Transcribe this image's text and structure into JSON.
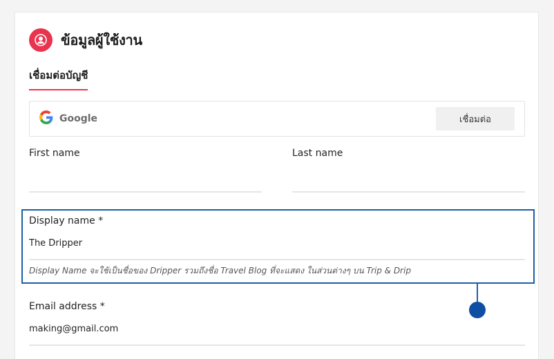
{
  "header": {
    "title": "ข้อมูลผู้ใช้งาน",
    "icon": "user-circle-icon",
    "accent_color": "#e8344f"
  },
  "tabs": [
    {
      "label": "เชื่อมต่อบัญชี",
      "active": true
    }
  ],
  "connect": {
    "provider_icon": "google-icon",
    "provider_label": "Google",
    "button_label": "เชื่อมต่อ"
  },
  "form": {
    "first_name": {
      "label": "First name",
      "value": ""
    },
    "last_name": {
      "label": "Last name",
      "value": ""
    },
    "display_name": {
      "label": "Display name *",
      "value": "The Dripper",
      "hint": "Display Name จะใช้เป็นชื่อของ Dripper รวมถึงชื่อ Travel Blog ที่จะแสดง ในส่วนต่างๆ บน Trip & Drip"
    },
    "email": {
      "label": "Email address *",
      "value": "making@gmail.com"
    }
  },
  "highlight_color": "#1a5fa8"
}
